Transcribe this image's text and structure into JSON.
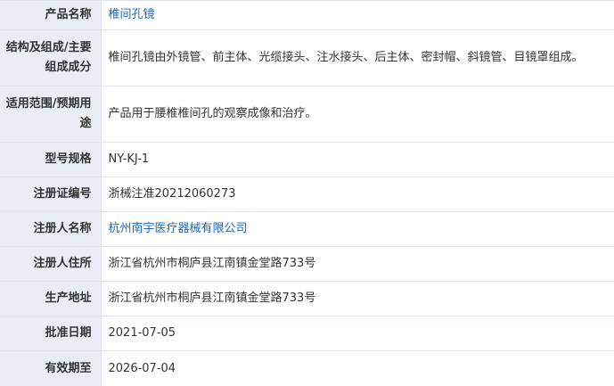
{
  "rows": [
    {
      "label": "产品名称",
      "value": "椎间孔镜"
    },
    {
      "label": "结构及组成/主要组成成分",
      "value": "椎间孔镜由外镜管、前主体、光缆接头、注水接头、后主体、密封帽、斜镜管、目镜罩组成。"
    },
    {
      "label": "适用范围/预期用途",
      "value": "产品用于腰椎椎间孔的观察成像和治疗。"
    },
    {
      "label": "型号规格",
      "value": "NY-KJ-1"
    },
    {
      "label": "注册证编号",
      "value": "浙械注准20212060273"
    },
    {
      "label": "注册人名称",
      "value": "杭州南宇医疗器械有限公司"
    },
    {
      "label": "注册人住所",
      "value": "浙江省杭州市桐庐县江南镇金堂路733号"
    },
    {
      "label": "生产地址",
      "value": "浙江省杭州市桐庐县江南镇金堂路733号"
    },
    {
      "label": "批准日期",
      "value": "2021-07-05"
    },
    {
      "label": "有效期至",
      "value": "2026-07-04"
    }
  ],
  "colors": {
    "label_bg": "#e8edf6",
    "border": "#dfe4ec",
    "link": "#1e66b3",
    "text": "#333333"
  }
}
